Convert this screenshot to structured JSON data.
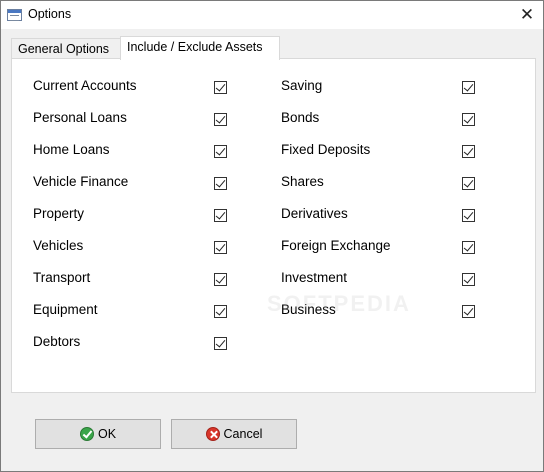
{
  "window": {
    "title": "Options",
    "close_glyph": "✕"
  },
  "tabs": [
    {
      "label": "General Options",
      "active": false
    },
    {
      "label": "Include / Exclude Assets",
      "active": true
    }
  ],
  "assets_left": [
    {
      "label": "Current Accounts",
      "checked": true
    },
    {
      "label": "Personal Loans",
      "checked": true
    },
    {
      "label": "Home Loans",
      "checked": true
    },
    {
      "label": "Vehicle Finance",
      "checked": true
    },
    {
      "label": "Property",
      "checked": true
    },
    {
      "label": "Vehicles",
      "checked": true
    },
    {
      "label": "Transport",
      "checked": true
    },
    {
      "label": "Equipment",
      "checked": true
    },
    {
      "label": "Debtors",
      "checked": true
    }
  ],
  "assets_right": [
    {
      "label": "Saving",
      "checked": true
    },
    {
      "label": "Bonds",
      "checked": true
    },
    {
      "label": "Fixed Deposits",
      "checked": true
    },
    {
      "label": "Shares",
      "checked": true
    },
    {
      "label": "Derivatives",
      "checked": true
    },
    {
      "label": "Foreign Exchange",
      "checked": true
    },
    {
      "label": "Investment",
      "checked": true
    },
    {
      "label": "Business",
      "checked": true
    }
  ],
  "watermark": "SOFTPEDIA",
  "buttons": {
    "ok_label": "OK",
    "cancel_label": "Cancel"
  },
  "colors": {
    "ok_icon": "#3aa54a",
    "cancel_icon": "#d8352a",
    "panel_bg": "#ffffff",
    "window_bg": "#f0f0f0"
  }
}
